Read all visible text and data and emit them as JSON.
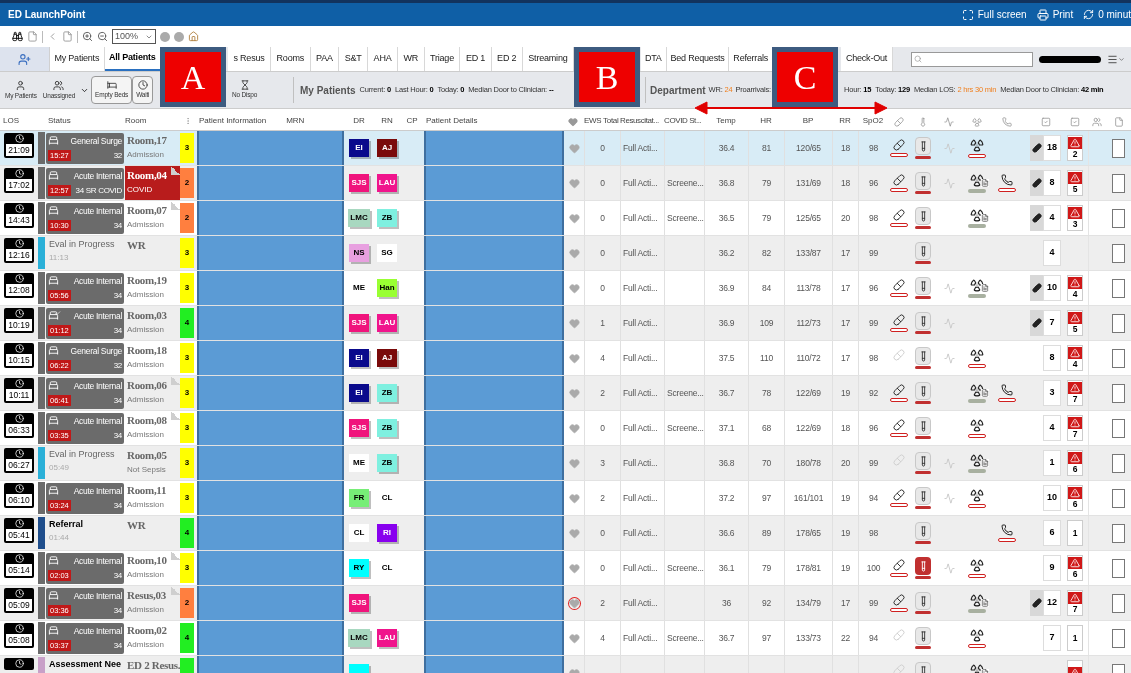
{
  "window": {
    "title": "ED LaunchPoint",
    "actions": [
      {
        "kind": "fullscreen",
        "label": "Full screen"
      },
      {
        "kind": "print",
        "label": "Print"
      },
      {
        "kind": "refresh",
        "label": "0 minut"
      }
    ]
  },
  "toolbar": {
    "zoom": "100%"
  },
  "tabs": [
    {
      "kind": "icon",
      "selected": false
    },
    {
      "label": "My Patients",
      "selected": false
    },
    {
      "label": "All Patients",
      "selected": true
    },
    {
      "kind": "gap"
    },
    {
      "label": "s Resus",
      "selected": false
    },
    {
      "label": "Rooms",
      "selected": false
    },
    {
      "label": "PAA",
      "selected": false
    },
    {
      "label": "S&T",
      "selected": false
    },
    {
      "label": "AHA",
      "selected": false
    },
    {
      "label": "WR",
      "selected": false
    },
    {
      "label": "Triage",
      "selected": false
    },
    {
      "label": "ED 1",
      "selected": false
    },
    {
      "label": "ED 2",
      "selected": false
    },
    {
      "label": "Streaming",
      "selected": false
    },
    {
      "kind": "gap"
    },
    {
      "label": "DTA",
      "selected": false
    },
    {
      "label": "Bed Requests",
      "selected": false
    },
    {
      "label": "Referrals",
      "selected": false
    },
    {
      "kind": "gap"
    },
    {
      "label": "Check-Out",
      "selected": false
    }
  ],
  "filters": [
    {
      "kind": "my",
      "label": "My Patients"
    },
    {
      "kind": "unassigned",
      "label": "Unassigned"
    },
    {
      "kind": "beds",
      "label": "Empty Beds"
    },
    {
      "kind": "waiting",
      "label": "Waiti"
    },
    {
      "kind": "gap"
    },
    {
      "kind": "dispo",
      "label": "No Dispo"
    }
  ],
  "my_stats": {
    "title": "My Patients",
    "items": [
      {
        "label": "Current:",
        "value": "0"
      },
      {
        "label": "Last Hour:",
        "value": "0"
      },
      {
        "label": "Today:",
        "value": "0"
      },
      {
        "label": "Median Door to Clinician:",
        "value": "--"
      }
    ]
  },
  "dept_stats": {
    "title": "Department",
    "items": [
      {
        "label": "WR:",
        "value": "24",
        "warn": true
      },
      {
        "label": "Proarrivals:"
      }
    ],
    "items_after": [
      {
        "label": "Hour:",
        "value": "15",
        "warn": false
      },
      {
        "label": "Today:",
        "value": "129",
        "warn": false
      },
      {
        "label": "Median LOS:",
        "value": "2 hrs 30 min",
        "warn": true
      },
      {
        "label": "Median Door to Clinician:",
        "value": "42 min",
        "warn": false
      }
    ]
  },
  "columns": {
    "los": "LOS",
    "status": "Status",
    "room": "Room",
    "patient_information": "Patient Information",
    "mrn": "MRN",
    "dr": "DR",
    "rn": "RN",
    "cp": "CP",
    "patient_details": "Patient Details",
    "ews": "EWS Total",
    "resus": "Resuscitat...",
    "covid": "COVID St...",
    "temp": "Temp",
    "hr": "HR",
    "bp": "BP",
    "rr": "RR",
    "spo2": "SpO2"
  },
  "rows": [
    {
      "selected": true,
      "checked": false,
      "los": "21:09",
      "status": {
        "kind": "bed",
        "color": "#6b6b6b",
        "service": "General Surge",
        "timer": "15:27",
        "info": "32",
        "bed_check": false
      },
      "room": {
        "text": "Room,17",
        "sub": "Admission",
        "alert": false,
        "note": false
      },
      "acuity": {
        "text": "3",
        "color": "#ffff00"
      },
      "dr": {
        "text": "EI",
        "color": "#0a0a8c"
      },
      "rn": {
        "text": "AJ",
        "color": "#7a0a0a"
      },
      "heart_alert": false,
      "ews": "0",
      "resus": "Full Acti...",
      "temp": "36.4",
      "hr": "81",
      "bp": "120/65",
      "rr": "18",
      "spo2": "98",
      "orders": [
        {
          "kind": "pill",
          "faded": false
        },
        {
          "kind": "tube",
          "alert": false
        },
        {
          "kind": "ecg",
          "faded": true
        },
        {
          "kind": "rad",
          "report": false
        }
      ],
      "count": {
        "text": "18",
        "pill": true
      },
      "alert": {
        "text": "2",
        "flag": true
      }
    },
    {
      "selected": false,
      "checked": false,
      "los": "17:02",
      "status": {
        "kind": "bed",
        "color": "#6b6b6b",
        "service": "Acute Internal",
        "timer": "12:57",
        "info": "34 SR COVID",
        "bed_check": false
      },
      "room": {
        "text": "Room,04",
        "sub": "COVID",
        "alert": true,
        "note": true
      },
      "acuity": {
        "text": "2",
        "color": "#ff7f3f"
      },
      "dr": {
        "text": "SJS",
        "color": "#f0147c"
      },
      "rn": {
        "text": "LAU",
        "color": "#f0148c"
      },
      "heart_alert": false,
      "ews": "0",
      "resus": "Full Acti...",
      "covid": "Screene...",
      "temp": "36.8",
      "hr": "79",
      "bp": "131/69",
      "rr": "18",
      "spo2": "96",
      "orders": [
        {
          "kind": "pill",
          "faded": false
        },
        {
          "kind": "tube",
          "alert": false
        },
        {
          "kind": "ecg",
          "faded": true
        },
        {
          "kind": "rad",
          "report": true
        },
        {
          "kind": "phone"
        }
      ],
      "count": {
        "text": "8",
        "pill": true
      },
      "alert": {
        "text": "5",
        "flag": true
      }
    },
    {
      "selected": false,
      "checked": false,
      "los": "14:43",
      "status": {
        "kind": "bed",
        "color": "#6b6b6b",
        "service": "Acute Internal",
        "timer": "10:30",
        "info": "34",
        "bed_check": false
      },
      "room": {
        "text": "Room,07",
        "sub": "Admission",
        "alert": false,
        "note": true
      },
      "acuity": {
        "text": "2",
        "color": "#ff7f3f"
      },
      "dr": {
        "text": "LMC",
        "color": "#a8d8c0"
      },
      "rn": {
        "text": "ZB",
        "color": "#7ff0e0"
      },
      "heart_alert": false,
      "ews": "0",
      "resus": "Full Acti...",
      "covid": "Screene...",
      "temp": "36.5",
      "hr": "79",
      "bp": "125/65",
      "rr": "20",
      "spo2": "98",
      "orders": [
        {
          "kind": "pill",
          "faded": false
        },
        {
          "kind": "tube",
          "alert": false
        },
        {
          "kind": "rad",
          "report": true
        }
      ],
      "count": {
        "text": "4",
        "pill": true
      },
      "alert": {
        "text": "3",
        "flag": true
      }
    },
    {
      "selected": false,
      "checked": false,
      "los": "12:16",
      "status": {
        "kind": "plain",
        "color": "#2ab0d8",
        "label": "Eval in Progress",
        "time": "11:13"
      },
      "room": {
        "text": "WR",
        "alert": false,
        "note": false
      },
      "acuity": {
        "text": "3",
        "color": "#ffff00"
      },
      "dr": {
        "text": "NS",
        "color": "#e8a0e0"
      },
      "rn": {
        "text": "SG",
        "color": "#ffffff"
      },
      "heart_alert": false,
      "ews": "0",
      "resus": "Full Acti...",
      "temp": "36.2",
      "hr": "82",
      "bp": "133/87",
      "rr": "17",
      "spo2": "99",
      "orders": [
        {
          "kind": "tube",
          "alert": false
        }
      ],
      "count": {
        "text": "4",
        "pill": false
      }
    },
    {
      "selected": false,
      "checked": false,
      "los": "12:08",
      "status": {
        "kind": "bed",
        "color": "#6b6b6b",
        "service": "Acute Internal",
        "timer": "05:56",
        "info": "34",
        "bed_check": false
      },
      "room": {
        "text": "Room,19",
        "sub": "Admission",
        "alert": false,
        "note": false
      },
      "acuity": {
        "text": "3",
        "color": "#ffff00"
      },
      "dr": {
        "text": "ME",
        "color": "#ffffff"
      },
      "rn": {
        "text": "Han",
        "color": "#99ff33"
      },
      "heart_alert": false,
      "ews": "0",
      "resus": "Full Acti...",
      "temp": "36.9",
      "hr": "84",
      "bp": "113/78",
      "rr": "17",
      "spo2": "96",
      "orders": [
        {
          "kind": "pill",
          "faded": false
        },
        {
          "kind": "tube",
          "alert": false
        },
        {
          "kind": "ecg",
          "faded": true
        },
        {
          "kind": "rad",
          "report": true
        }
      ],
      "count": {
        "text": "10",
        "pill": true
      },
      "alert": {
        "text": "4",
        "flag": true
      }
    },
    {
      "selected": false,
      "checked": false,
      "los": "10:19",
      "status": {
        "kind": "bed",
        "color": "#6b6b6b",
        "service": "Acute Internal",
        "timer": "01:12",
        "info": "34",
        "bed_check": true
      },
      "room": {
        "text": "Room,03",
        "sub": "Admission",
        "alert": false,
        "note": false
      },
      "acuity": {
        "text": "4",
        "color": "#22ee22"
      },
      "dr": {
        "text": "SJS",
        "color": "#f0147c"
      },
      "rn": {
        "text": "LAU",
        "color": "#f0148c"
      },
      "heart_alert": false,
      "ews": "1",
      "resus": "Full Acti...",
      "temp": "36.9",
      "hr": "109",
      "bp": "112/73",
      "rr": "17",
      "spo2": "99",
      "orders": [
        {
          "kind": "pill",
          "faded": false
        },
        {
          "kind": "tube",
          "alert": false
        },
        {
          "kind": "ecg",
          "faded": true
        }
      ],
      "count": {
        "text": "7",
        "pill": true
      },
      "alert": {
        "text": "5",
        "flag": true
      }
    },
    {
      "selected": false,
      "checked": false,
      "los": "10:15",
      "status": {
        "kind": "bed",
        "color": "#6b6b6b",
        "service": "General Surge",
        "timer": "06:22",
        "info": "32",
        "bed_check": false
      },
      "room": {
        "text": "Room,18",
        "sub": "Admission",
        "alert": false,
        "note": false
      },
      "acuity": {
        "text": "3",
        "color": "#ffff00"
      },
      "dr": {
        "text": "EI",
        "color": "#0a0a8c"
      },
      "rn": {
        "text": "AJ",
        "color": "#7a0a0a"
      },
      "heart_alert": false,
      "ews": "4",
      "resus": "Full Acti...",
      "temp": "37.5",
      "hr": "110",
      "bp": "110/72",
      "rr": "17",
      "spo2": "98",
      "orders": [
        {
          "kind": "pill",
          "faded": true
        },
        {
          "kind": "tube",
          "alert": false
        },
        {
          "kind": "ecg",
          "faded": true
        },
        {
          "kind": "rad",
          "report": false
        }
      ],
      "count": {
        "text": "8",
        "pill": false
      },
      "alert": {
        "text": "4",
        "flag": true
      }
    },
    {
      "selected": false,
      "checked": false,
      "los": "10:11",
      "status": {
        "kind": "bed",
        "color": "#6b6b6b",
        "service": "Acute Internal",
        "timer": "06:41",
        "info": "34",
        "bed_check": false
      },
      "room": {
        "text": "Room,06",
        "sub": "Admission",
        "alert": false,
        "note": true
      },
      "acuity": {
        "text": "3",
        "color": "#ffff00"
      },
      "dr": {
        "text": "EI",
        "color": "#0a0a8c"
      },
      "rn": {
        "text": "ZB",
        "color": "#7ff0e0"
      },
      "heart_alert": false,
      "ews": "2",
      "resus": "Full Acti...",
      "covid": "Screene...",
      "temp": "36.7",
      "hr": "78",
      "bp": "122/69",
      "rr": "19",
      "spo2": "92",
      "orders": [
        {
          "kind": "pill",
          "faded": false
        },
        {
          "kind": "tube",
          "alert": false
        },
        {
          "kind": "rad",
          "report": true
        },
        {
          "kind": "phone"
        }
      ],
      "count": {
        "text": "3",
        "pill": false
      },
      "alert": {
        "text": "7",
        "flag": true
      }
    },
    {
      "selected": false,
      "checked": false,
      "los": "06:33",
      "status": {
        "kind": "bed",
        "color": "#6b6b6b",
        "service": "Acute Internal",
        "timer": "03:35",
        "info": "34",
        "bed_check": false
      },
      "room": {
        "text": "Room,08",
        "sub": "Admission",
        "alert": false,
        "note": true
      },
      "acuity": {
        "text": "3",
        "color": "#ffff00"
      },
      "dr": {
        "text": "SJS",
        "color": "#f0147c"
      },
      "rn": {
        "text": "ZB",
        "color": "#7ff0e0"
      },
      "heart_alert": false,
      "ews": "0",
      "resus": "Full Acti...",
      "covid": "Screene...",
      "temp": "37.1",
      "hr": "68",
      "bp": "122/69",
      "rr": "18",
      "spo2": "96",
      "orders": [
        {
          "kind": "pill",
          "faded": false
        },
        {
          "kind": "tube",
          "alert": false
        },
        {
          "kind": "rad",
          "report": false
        }
      ],
      "count": {
        "text": "4",
        "pill": false
      },
      "alert": {
        "text": "7",
        "flag": true
      }
    },
    {
      "selected": false,
      "checked": false,
      "los": "06:27",
      "status": {
        "kind": "plain",
        "color": "#2ab0d8",
        "label": "Eval in Progress",
        "time": "05:49"
      },
      "room": {
        "text": "Room,05",
        "sub": "Not Sepsis",
        "alert": false,
        "note": false
      },
      "acuity": {
        "text": "3",
        "color": "#ffff00"
      },
      "dr": {
        "text": "ME",
        "color": "#ffffff"
      },
      "rn": {
        "text": "ZB",
        "color": "#7ff0e0"
      },
      "heart_alert": false,
      "ews": "3",
      "resus": "Full Acti...",
      "temp": "36.8",
      "hr": "70",
      "bp": "180/78",
      "rr": "20",
      "spo2": "99",
      "orders": [
        {
          "kind": "pill",
          "faded": true
        },
        {
          "kind": "tube",
          "alert": false
        },
        {
          "kind": "ecg",
          "faded": true
        },
        {
          "kind": "rad",
          "report": true
        }
      ],
      "count": {
        "text": "1",
        "pill": false
      },
      "alert": {
        "text": "6",
        "flag": true
      }
    },
    {
      "selected": false,
      "checked": false,
      "los": "06:10",
      "status": {
        "kind": "bed",
        "color": "#6b6b6b",
        "service": "Acute Internal",
        "timer": "03:24",
        "info": "34",
        "bed_check": false
      },
      "room": {
        "text": "Room,11",
        "sub": "Admission",
        "alert": false,
        "note": false
      },
      "acuity": {
        "text": "3",
        "color": "#ffff00"
      },
      "dr": {
        "text": "FR",
        "color": "#77ee77"
      },
      "rn": {
        "text": "CL",
        "color": "#ffffff"
      },
      "heart_alert": false,
      "ews": "2",
      "resus": "Full Acti...",
      "temp": "37.2",
      "hr": "97",
      "bp": "161/101",
      "rr": "19",
      "spo2": "94",
      "orders": [
        {
          "kind": "pill",
          "faded": false
        },
        {
          "kind": "tube",
          "alert": false
        },
        {
          "kind": "ecg",
          "faded": true
        },
        {
          "kind": "rad",
          "report": false
        }
      ],
      "count": {
        "text": "10",
        "pill": false
      },
      "alert": {
        "text": "6",
        "flag": true
      }
    },
    {
      "selected": false,
      "checked": false,
      "los": "05:41",
      "status": {
        "kind": "bold",
        "color": "#1f4e8c",
        "label": "Referral",
        "time": "01:44"
      },
      "room": {
        "text": "WR",
        "alert": false,
        "note": false
      },
      "acuity": {
        "text": "4",
        "color": "#22ee22"
      },
      "dr": {
        "text": "CL",
        "color": "#ffffff"
      },
      "rn": {
        "text": "RI",
        "color": "#8800ee"
      },
      "heart_alert": false,
      "ews": "0",
      "resus": "Full Acti...",
      "temp": "36.6",
      "hr": "89",
      "bp": "178/65",
      "rr": "19",
      "spo2": "98",
      "orders": [
        {
          "kind": "tube",
          "alert": false
        },
        {
          "kind": "phone"
        }
      ],
      "count": {
        "text": "6",
        "pill": false
      },
      "alert": {
        "text": "1",
        "flag": false
      }
    },
    {
      "selected": false,
      "checked": false,
      "los": "05:14",
      "status": {
        "kind": "bed",
        "color": "#6b6b6b",
        "service": "Acute Internal",
        "timer": "02:03",
        "info": "34",
        "bed_check": false
      },
      "room": {
        "text": "Room,10",
        "sub": "Admission",
        "alert": false,
        "note": true
      },
      "acuity": {
        "text": "3",
        "color": "#ffff00"
      },
      "dr": {
        "text": "RY",
        "color": "#00ffff"
      },
      "rn": {
        "text": "CL",
        "color": "#ffffff"
      },
      "heart_alert": false,
      "ews": "0",
      "resus": "Full Acti...",
      "covid": "Screene...",
      "temp": "36.1",
      "hr": "79",
      "bp": "178/81",
      "rr": "19",
      "spo2": "100",
      "orders": [
        {
          "kind": "pill",
          "faded": false
        },
        {
          "kind": "tube",
          "alert": true
        },
        {
          "kind": "ecg",
          "faded": true
        },
        {
          "kind": "rad",
          "report": false
        }
      ],
      "count": {
        "text": "9",
        "pill": false
      },
      "alert": {
        "text": "6",
        "flag": true
      }
    },
    {
      "selected": false,
      "checked": false,
      "los": "05:09",
      "status": {
        "kind": "bed",
        "color": "#6b6b6b",
        "service": "Acute Internal",
        "timer": "03:36",
        "info": "34",
        "bed_check": false
      },
      "room": {
        "text": "Resus,03",
        "sub": "Admission",
        "alert": false,
        "note": true
      },
      "acuity": {
        "text": "2",
        "color": "#ff7f3f"
      },
      "dr": {
        "text": "SJS",
        "color": "#f0147c"
      },
      "heart_alert": true,
      "ews": "2",
      "resus": "Full Acti...",
      "temp": "36",
      "hr": "92",
      "bp": "134/79",
      "rr": "17",
      "spo2": "99",
      "orders": [
        {
          "kind": "pill",
          "faded": false
        },
        {
          "kind": "tube",
          "alert": false
        },
        {
          "kind": "rad",
          "report": true
        }
      ],
      "count": {
        "text": "12",
        "pill": true
      },
      "alert": {
        "text": "7",
        "flag": true
      }
    },
    {
      "selected": false,
      "checked": false,
      "los": "05:08",
      "status": {
        "kind": "bed",
        "color": "#6b6b6b",
        "service": "Acute Internal",
        "timer": "03:37",
        "info": "34",
        "bed_check": false
      },
      "room": {
        "text": "Room,02",
        "sub": "Admission",
        "alert": false,
        "note": false
      },
      "acuity": {
        "text": "4",
        "color": "#22ee22"
      },
      "dr": {
        "text": "LMC",
        "color": "#a8d8c0"
      },
      "rn": {
        "text": "LAU",
        "color": "#f0148c"
      },
      "heart_alert": false,
      "ews": "4",
      "resus": "Full Acti...",
      "covid": "Screene...",
      "temp": "36.7",
      "hr": "97",
      "bp": "133/73",
      "rr": "22",
      "spo2": "94",
      "orders": [
        {
          "kind": "pill",
          "faded": true
        },
        {
          "kind": "tube",
          "alert": false
        },
        {
          "kind": "rad",
          "report": false
        }
      ],
      "count": {
        "text": "7",
        "pill": false
      },
      "alert": {
        "text": "1",
        "flag": false
      }
    },
    {
      "selected": false,
      "checked": false,
      "status": {
        "kind": "bold",
        "color": "#c8a0c8",
        "label": "Assessment Nee"
      },
      "room": {
        "text": "ED 2 Resus.",
        "alert": false,
        "note": false
      },
      "acuity": {
        "color": "#22ee22"
      },
      "dr": {
        "color": "#00ffff"
      },
      "heart_alert": false,
      "orders": [
        {
          "kind": "pill",
          "faded": true
        },
        {
          "kind": "tube",
          "alert": false
        },
        {
          "kind": "rad",
          "report": true
        }
      ],
      "alert": {
        "flag": true
      }
    }
  ],
  "callouts": [
    {
      "label": "A"
    },
    {
      "label": "B"
    },
    {
      "label": "C"
    }
  ]
}
